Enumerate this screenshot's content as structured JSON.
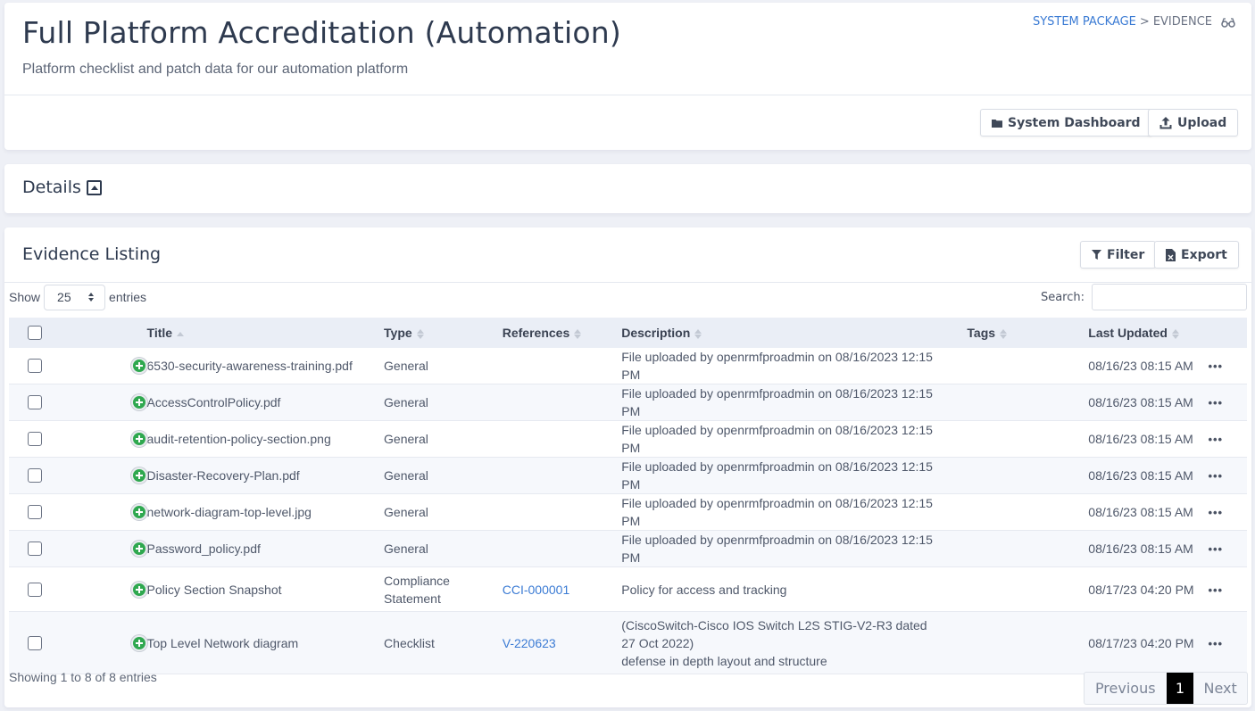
{
  "header": {
    "title": "Full Platform Accreditation (Automation)",
    "subtitle": "Platform checklist and patch data for our automation platform",
    "breadcrumb": {
      "link": "SYSTEM PACKAGE",
      "separator": ">",
      "current": "EVIDENCE",
      "icon": "glasses-icon"
    },
    "buttons": {
      "system_dashboard": "System Dashboard",
      "upload": "Upload"
    }
  },
  "details": {
    "title": "Details",
    "toggle_icon": "collapse-up-icon"
  },
  "evidence": {
    "title": "Evidence Listing",
    "buttons": {
      "filter": "Filter",
      "export": "Export"
    },
    "length": {
      "label_before": "Show",
      "value": "25",
      "label_after": "entries"
    },
    "search": {
      "label": "Search:",
      "value": "",
      "placeholder": ""
    },
    "columns": [
      "Title",
      "Type",
      "References",
      "Description",
      "Tags",
      "Last Updated"
    ],
    "rows": [
      {
        "title": "6530-security-awareness-training.pdf",
        "type": "General",
        "references": "",
        "description": "File uploaded by openrmfproadmin on 08/16/2023 12:15 PM",
        "tags": "",
        "updated": "08/16/23 08:15 AM"
      },
      {
        "title": "AccessControlPolicy.pdf",
        "type": "General",
        "references": "",
        "description": "File uploaded by openrmfproadmin on 08/16/2023 12:15 PM",
        "tags": "",
        "updated": "08/16/23 08:15 AM"
      },
      {
        "title": "audit-retention-policy-section.png",
        "type": "General",
        "references": "",
        "description": "File uploaded by openrmfproadmin on 08/16/2023 12:15 PM",
        "tags": "",
        "updated": "08/16/23 08:15 AM"
      },
      {
        "title": "Disaster-Recovery-Plan.pdf",
        "type": "General",
        "references": "",
        "description": "File uploaded by openrmfproadmin on 08/16/2023 12:15 PM",
        "tags": "",
        "updated": "08/16/23 08:15 AM"
      },
      {
        "title": "network-diagram-top-level.jpg",
        "type": "General",
        "references": "",
        "description": "File uploaded by openrmfproadmin on 08/16/2023 12:15 PM",
        "tags": "",
        "updated": "08/16/23 08:15 AM"
      },
      {
        "title": "Password_policy.pdf",
        "type": "General",
        "references": "",
        "description": "File uploaded by openrmfproadmin on 08/16/2023 12:15 PM",
        "tags": "",
        "updated": "08/16/23 08:15 AM"
      },
      {
        "title": "Policy Section Snapshot",
        "type": "Compliance Statement",
        "references": "CCI-000001",
        "description": "Policy for access and tracking",
        "tags": "",
        "updated": "08/17/23 04:20 PM"
      },
      {
        "title": "Top Level Network diagram",
        "type": "Checklist",
        "references": "V-220623",
        "description": "(CiscoSwitch-Cisco IOS Switch L2S STIG-V2-R3 dated 27 Oct 2022)",
        "description_line2": "defense in depth layout and structure",
        "tags": "",
        "updated": "08/17/23 04:20 PM"
      }
    ],
    "row_action_icon": "ellipsis-icon",
    "info": "Showing 1 to 8 of 8 entries",
    "pagination": {
      "previous": "Previous",
      "current": "1",
      "next": "Next"
    }
  },
  "colors": {
    "link": "#3b7bd4",
    "add_icon": "#2fa84f",
    "active_page": "#000000",
    "header_row": "#eaeef6",
    "page_bg": "#eef0f6"
  }
}
